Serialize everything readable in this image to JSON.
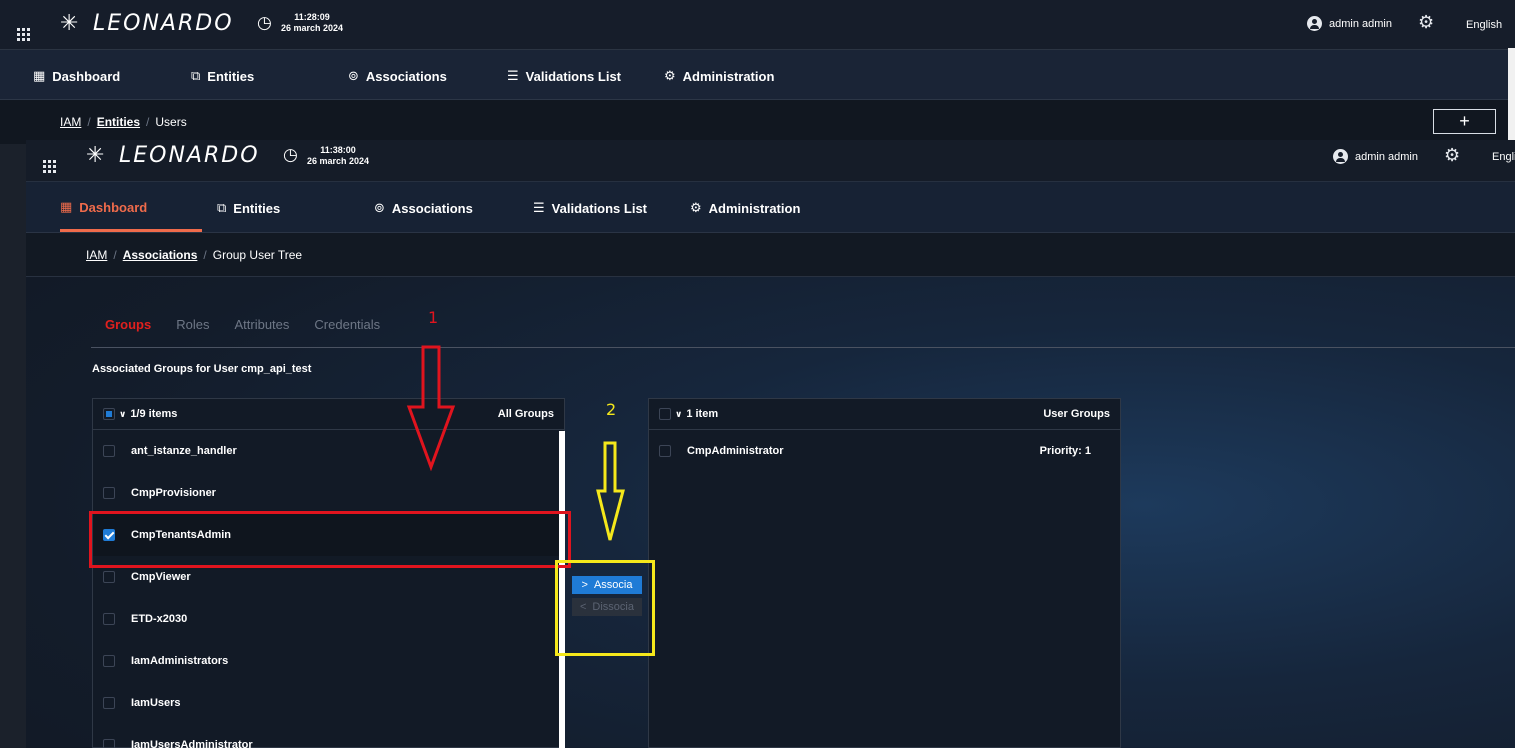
{
  "background_screen": {
    "logo": "LEONARDO",
    "time": "11:28:09",
    "date": "26 march 2024",
    "user": "admin admin",
    "language": "English",
    "nav": [
      "Dashboard",
      "Entities",
      "Associations",
      "Validations List",
      "Administration"
    ],
    "breadcrumb": [
      "IAM",
      "Entities",
      "Users"
    ],
    "add_button": "+"
  },
  "header": {
    "logo": "LEONARDO",
    "time": "11:38:00",
    "date": "26 march 2024",
    "user": "admin admin",
    "language": "Engli"
  },
  "nav": {
    "items": [
      {
        "label": "Dashboard",
        "icon": "dashboard-icon",
        "active": true
      },
      {
        "label": "Entities",
        "icon": "entities-icon"
      },
      {
        "label": "Associations",
        "icon": "associations-icon"
      },
      {
        "label": "Validations List",
        "icon": "list-icon"
      },
      {
        "label": "Administration",
        "icon": "gear-icon"
      }
    ],
    "active_color": "#ef6b4b"
  },
  "breadcrumb": [
    "IAM",
    "Associations",
    "Group User Tree"
  ],
  "tabs": [
    "Groups",
    "Roles",
    "Attributes",
    "Credentials"
  ],
  "active_tab": "Groups",
  "section_title": "Associated Groups for User cmp_api_test",
  "left_list": {
    "count": "1/9 items",
    "title": "All Groups",
    "items": [
      {
        "name": "ant_istanze_handler",
        "checked": false
      },
      {
        "name": "CmpProvisioner",
        "checked": false
      },
      {
        "name": "CmpTenantsAdmin",
        "checked": true
      },
      {
        "name": "CmpViewer",
        "checked": false
      },
      {
        "name": "ETD-x2030",
        "checked": false
      },
      {
        "name": "IamAdministrators",
        "checked": false
      },
      {
        "name": "IamUsers",
        "checked": false
      },
      {
        "name": "IamUsersAdministrator",
        "checked": false
      }
    ]
  },
  "right_list": {
    "count": "1 item",
    "title": "User Groups",
    "items": [
      {
        "name": "CmpAdministrator",
        "priority": "Priority: 1"
      }
    ]
  },
  "actions": {
    "associate": "Associa",
    "dissociate": "Dissocia",
    "associate_glyph": ">",
    "dissociate_glyph": "<"
  },
  "annotations": {
    "step1": "1",
    "step2": "2",
    "step1_color": "#e0141e",
    "step2_color": "#f5e81b"
  },
  "colors": {
    "accent_blue": "#1f7bd6",
    "selected_tab": "#e0201e"
  }
}
